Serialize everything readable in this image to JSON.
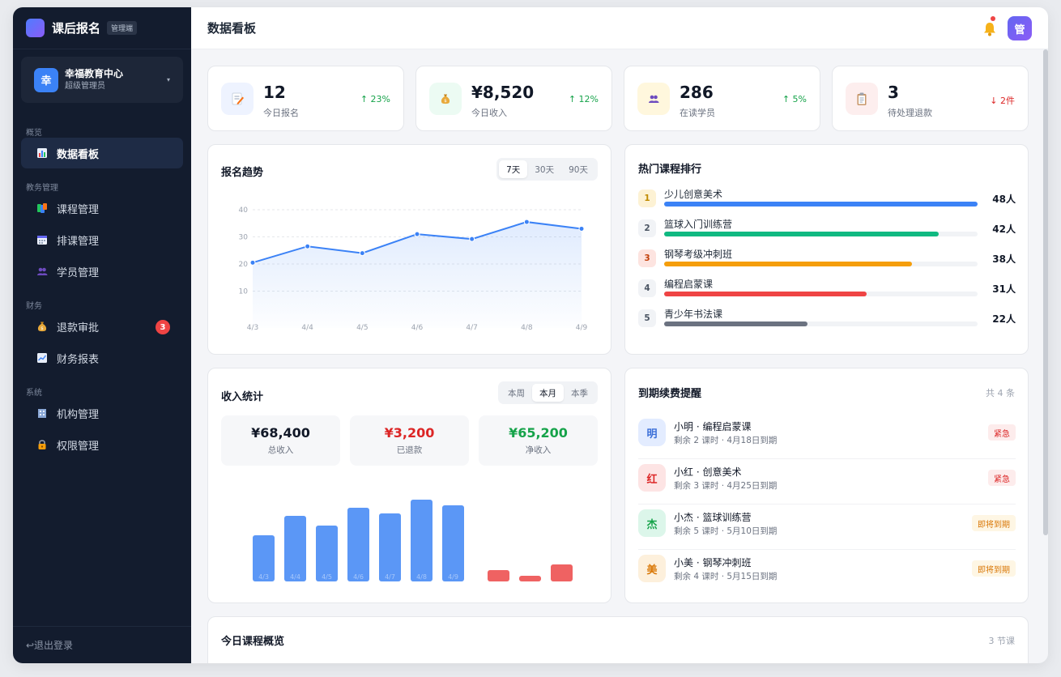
{
  "brand": {
    "title": "课后报名",
    "tag": "管理端"
  },
  "org": {
    "avatar": "幸",
    "name": "幸福教育中心",
    "role": "超级管理员",
    "caret": "▾"
  },
  "nav": {
    "sections": [
      {
        "label": "概览",
        "items": [
          {
            "label": "数据看板",
            "icon": "chart-icon",
            "active": true
          }
        ]
      },
      {
        "label": "教务管理",
        "items": [
          {
            "label": "课程管理",
            "icon": "books-icon"
          },
          {
            "label": "排课管理",
            "icon": "calendar-icon"
          },
          {
            "label": "学员管理",
            "icon": "users-icon"
          }
        ]
      },
      {
        "label": "财务",
        "items": [
          {
            "label": "退款审批",
            "icon": "money-bag-icon",
            "badge": "3"
          },
          {
            "label": "财务报表",
            "icon": "trend-icon"
          }
        ]
      },
      {
        "label": "系统",
        "items": [
          {
            "label": "机构管理",
            "icon": "building-icon"
          },
          {
            "label": "权限管理",
            "icon": "lock-icon"
          }
        ]
      }
    ],
    "logout": "↩退出登录"
  },
  "header": {
    "title": "数据看板",
    "user_avatar": "管"
  },
  "stats": [
    {
      "value": "12",
      "label": "今日报名",
      "trend": "↑ 23%",
      "trend_color": "#16a34a",
      "icon": "memo-icon",
      "bg": "#eef3ff"
    },
    {
      "value": "¥8,520",
      "label": "今日收入",
      "trend": "↑ 12%",
      "trend_color": "#16a34a",
      "icon": "money-bag-icon",
      "bg": "#ecfbf3"
    },
    {
      "value": "286",
      "label": "在读学员",
      "trend": "↑ 5%",
      "trend_color": "#16a34a",
      "icon": "users-icon",
      "bg": "#fff7dd"
    },
    {
      "value": "3",
      "label": "待处理退款",
      "trend": "↓ 2件",
      "trend_color": "#dc2626",
      "icon": "clipboard-icon",
      "bg": "#fdeeee"
    }
  ],
  "trend_card": {
    "title": "报名趋势",
    "ranges": [
      "7天",
      "30天",
      "90天"
    ],
    "selected": "7天"
  },
  "chart_data": [
    {
      "type": "line",
      "x": [
        "4/3",
        "4/4",
        "4/5",
        "4/6",
        "4/7",
        "4/8",
        "4/9"
      ],
      "values": [
        20.5,
        26.5,
        24,
        31,
        29.2,
        35.5,
        33
      ],
      "yticks": [
        10,
        20,
        30,
        40
      ],
      "ylim": [
        0,
        40
      ],
      "color": "#3b82f6",
      "area": true
    },
    {
      "type": "bar",
      "categories": [
        "4/3",
        "4/4",
        "4/5",
        "4/6",
        "4/7",
        "4/8",
        "4/9"
      ],
      "series": [
        {
          "values": [
            57,
            81,
            69,
            91,
            84,
            101,
            94
          ],
          "color": "#5b97f6"
        }
      ],
      "refund_bars": [
        {
          "value": 14
        },
        {
          "value": 7
        },
        {
          "value": 21
        }
      ],
      "refund_color": "#ef6262"
    }
  ],
  "popular": {
    "title": "热门课程排行",
    "items": [
      {
        "rank": "1",
        "name": "少儿创意美术",
        "count": "48人",
        "value": 48,
        "color": "#3b82f6",
        "badge_bg": "#fdf2d4",
        "badge_fg": "#c08a00"
      },
      {
        "rank": "2",
        "name": "篮球入门训练营",
        "count": "42人",
        "value": 42,
        "color": "#10b981",
        "badge_bg": "#f1f3f6",
        "badge_fg": "#4b5563"
      },
      {
        "rank": "3",
        "name": "钢琴考级冲刺班",
        "count": "38人",
        "value": 38,
        "color": "#f59e0b",
        "badge_bg": "#fde4e0",
        "badge_fg": "#c2410c"
      },
      {
        "rank": "4",
        "name": "编程启蒙课",
        "count": "31人",
        "value": 31,
        "color": "#ef4444",
        "badge_bg": "#f1f3f6",
        "badge_fg": "#4b5563"
      },
      {
        "rank": "5",
        "name": "青少年书法课",
        "count": "22人",
        "value": 22,
        "color": "#6b7280",
        "badge_bg": "#f1f3f6",
        "badge_fg": "#4b5563"
      }
    ],
    "max": 48
  },
  "income": {
    "title": "收入统计",
    "ranges": [
      "本周",
      "本月",
      "本季"
    ],
    "selected": "本月",
    "summary": [
      {
        "value": "¥68,400",
        "label": "总收入",
        "color": "#111827"
      },
      {
        "value": "¥3,200",
        "label": "已退款",
        "color": "#dc2626"
      },
      {
        "value": "¥65,200",
        "label": "净收入",
        "color": "#16a34a"
      }
    ]
  },
  "reminders": {
    "title": "到期续费提醒",
    "count": "共 4 条",
    "items": [
      {
        "avatar": "明",
        "title": "小明 · 编程启蒙课",
        "sub": "剩余 2 课时 · 4月18日到期",
        "tag": "紧急",
        "av_bg": "#e3ecff",
        "av_fg": "#3b6fd8",
        "tag_bg": "#fdecec",
        "tag_fg": "#dc2626"
      },
      {
        "avatar": "红",
        "title": "小红 · 创意美术",
        "sub": "剩余 3 课时 · 4月25日到期",
        "tag": "紧急",
        "av_bg": "#fde4e4",
        "av_fg": "#dc2626",
        "tag_bg": "#fdecec",
        "tag_fg": "#dc2626"
      },
      {
        "avatar": "杰",
        "title": "小杰 · 篮球训练营",
        "sub": "剩余 5 课时 · 5月10日到期",
        "tag": "即将到期",
        "av_bg": "#dcf6ea",
        "av_fg": "#16a34a",
        "tag_bg": "#fef6e4",
        "tag_fg": "#d97706"
      },
      {
        "avatar": "美",
        "title": "小美 · 钢琴冲刺班",
        "sub": "剩余 4 课时 · 5月15日到期",
        "tag": "即将到期",
        "av_bg": "#fdf0dc",
        "av_fg": "#d97706",
        "tag_bg": "#fef6e4",
        "tag_fg": "#d97706"
      }
    ]
  },
  "today": {
    "title": "今日课程概览",
    "count": "3 节课"
  }
}
